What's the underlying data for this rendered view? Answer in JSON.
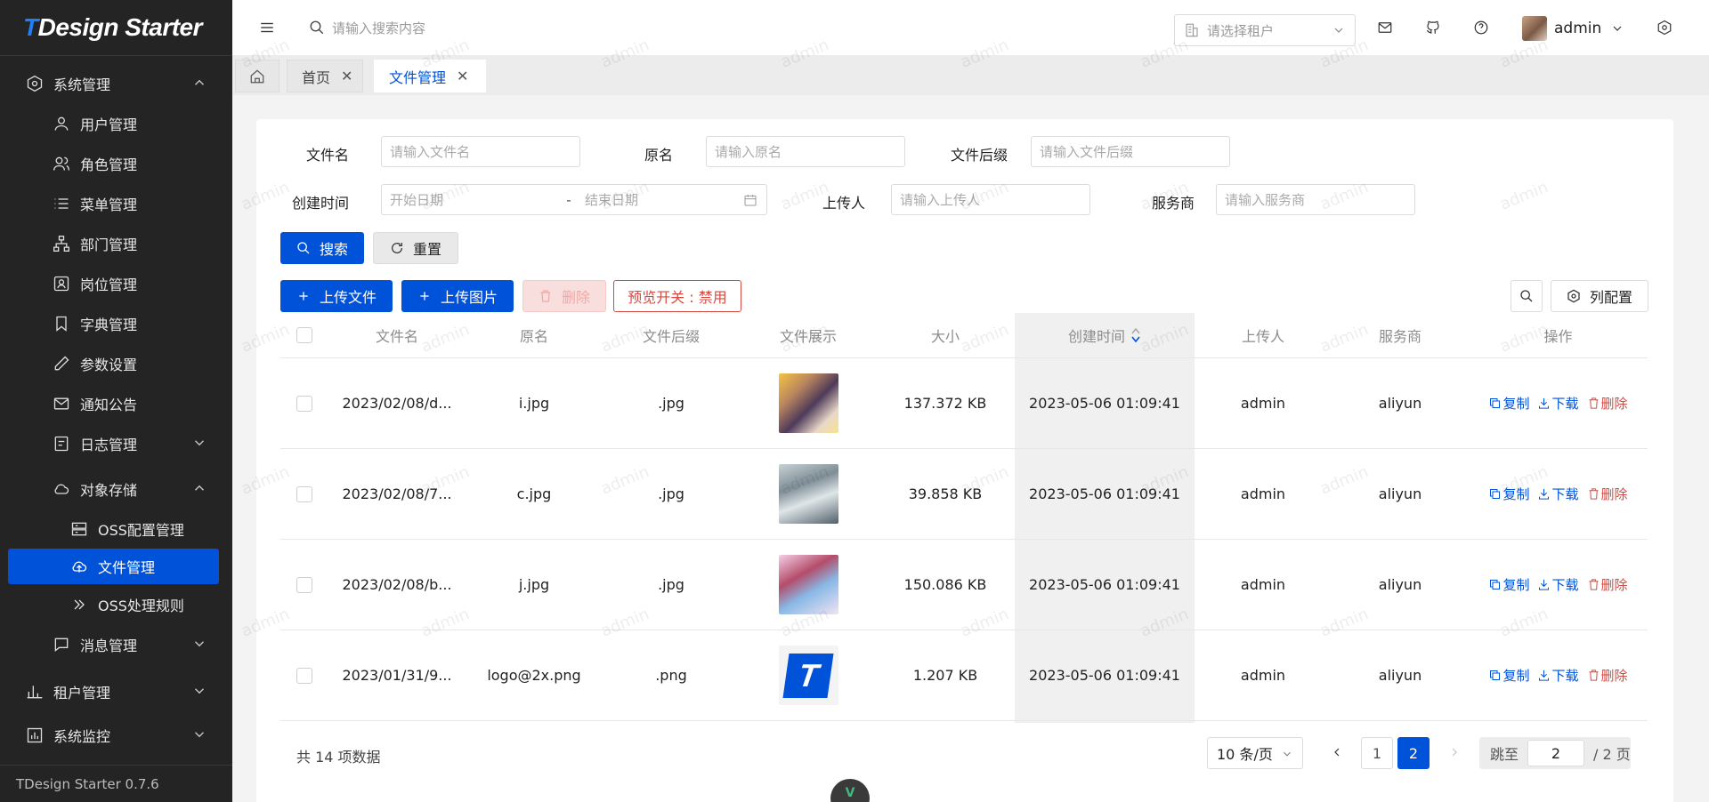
{
  "app": {
    "logo_prefix": "T",
    "logo_text": "TDesign Starter",
    "version": "TDesign Starter 0.7.6"
  },
  "sidebar": {
    "items": [
      {
        "label": "系统管理",
        "icon": "settings-icon"
      },
      {
        "label": "用户管理",
        "icon": "user-icon"
      },
      {
        "label": "角色管理",
        "icon": "users-icon"
      },
      {
        "label": "菜单管理",
        "icon": "list-icon"
      },
      {
        "label": "部门管理",
        "icon": "org-chart-icon"
      },
      {
        "label": "岗位管理",
        "icon": "badge-icon"
      },
      {
        "label": "字典管理",
        "icon": "bookmark-icon"
      },
      {
        "label": "参数设置",
        "icon": "pen-icon"
      },
      {
        "label": "通知公告",
        "icon": "mail-icon"
      },
      {
        "label": "日志管理",
        "icon": "log-icon"
      },
      {
        "label": "对象存储",
        "icon": "cloud-icon"
      },
      {
        "label": "OSS配置管理",
        "icon": "server-icon"
      },
      {
        "label": "文件管理",
        "icon": "cloud-upload-icon"
      },
      {
        "label": "OSS处理规则",
        "icon": "double-chevron-icon"
      },
      {
        "label": "消息管理",
        "icon": "chat-icon"
      },
      {
        "label": "租户管理",
        "icon": "bar-chart-icon"
      },
      {
        "label": "系统监控",
        "icon": "monitor-icon"
      }
    ]
  },
  "header": {
    "search_placeholder": "请输入搜索内容",
    "tenant_placeholder": "请选择租户",
    "username": "admin"
  },
  "tabs": [
    {
      "label": "首页",
      "close": "✕"
    },
    {
      "label": "文件管理",
      "close": "✕"
    }
  ],
  "filters": {
    "filename_label": "文件名",
    "filename_placeholder": "请输入文件名",
    "original_label": "原名",
    "original_placeholder": "请输入原名",
    "suffix_label": "文件后缀",
    "suffix_placeholder": "请输入文件后缀",
    "created_label": "创建时间",
    "start_placeholder": "开始日期",
    "range_sep": "-",
    "end_placeholder": "结束日期",
    "uploader_label": "上传人",
    "uploader_placeholder": "请输入上传人",
    "provider_label": "服务商",
    "provider_placeholder": "请输入服务商"
  },
  "actions": {
    "search": "搜索",
    "reset": "重置",
    "upload_file": "上传文件",
    "upload_image": "上传图片",
    "delete": "删除",
    "preview_switch": "预览开关 : 禁用",
    "column_config": "列配置"
  },
  "table": {
    "columns": [
      "文件名",
      "原名",
      "文件后缀",
      "文件展示",
      "大小",
      "创建时间",
      "上传人",
      "服务商",
      "操作"
    ],
    "rows": [
      {
        "filename": "2023/02/08/d...",
        "original": "i.jpg",
        "suffix": ".jpg",
        "size": "137.372 KB",
        "created": "2023-05-06 01:09:41",
        "uploader": "admin",
        "provider": "aliyun"
      },
      {
        "filename": "2023/02/08/7...",
        "original": "c.jpg",
        "suffix": ".jpg",
        "size": "39.858 KB",
        "created": "2023-05-06 01:09:41",
        "uploader": "admin",
        "provider": "aliyun"
      },
      {
        "filename": "2023/02/08/b...",
        "original": "j.jpg",
        "suffix": ".jpg",
        "size": "150.086 KB",
        "created": "2023-05-06 01:09:41",
        "uploader": "admin",
        "provider": "aliyun"
      },
      {
        "filename": "2023/01/31/9...",
        "original": "logo@2x.png",
        "suffix": ".png",
        "size": "1.207 KB",
        "created": "2023-05-06 01:09:41",
        "uploader": "admin",
        "provider": "aliyun"
      }
    ],
    "op_copy": "复制",
    "op_download": "下载",
    "op_delete": "删除"
  },
  "pagination": {
    "total": "共 14 项数据",
    "page_size": "10 条/页",
    "pages": [
      "1",
      "2"
    ],
    "jump_label": "跳至",
    "jump_value": "2",
    "total_pages": "/ 2 页"
  },
  "watermark_text": "admin",
  "colors": {
    "primary": "#0052d9",
    "danger": "#d54941",
    "sidebar_bg": "#242424"
  }
}
